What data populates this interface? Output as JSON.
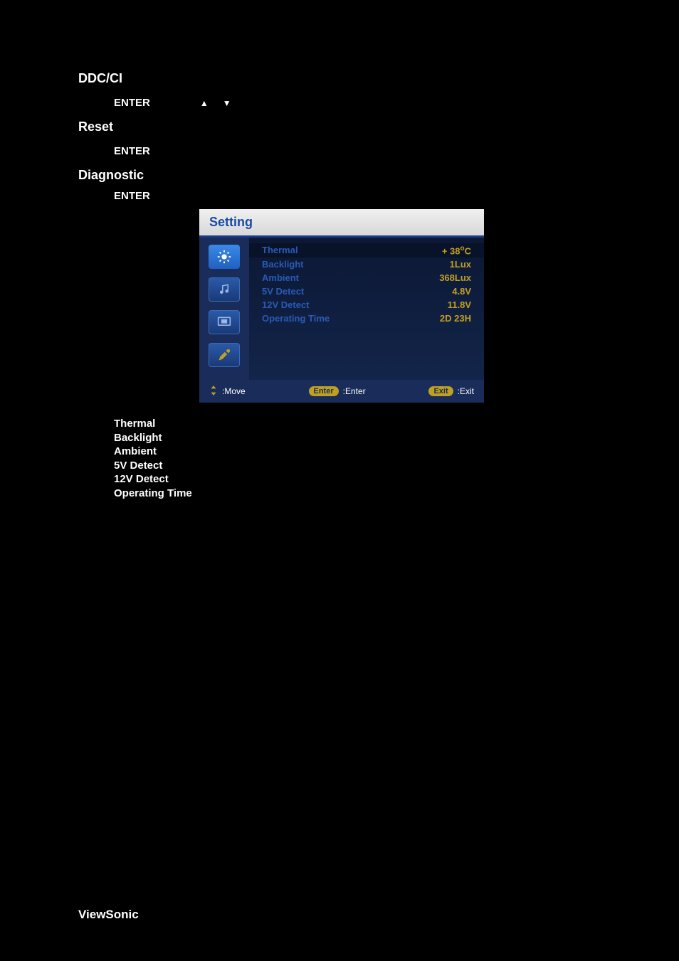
{
  "sections": {
    "ddcci": {
      "title": "DDC/CI",
      "enter": "ENTER"
    },
    "reset": {
      "title": "Reset",
      "enter": "ENTER"
    },
    "diagnostic": {
      "title": "Diagnostic",
      "enter": "ENTER"
    }
  },
  "osd": {
    "title": "Setting",
    "rows": [
      {
        "label": "Thermal",
        "value_prefix": "+ 38",
        "value_suffix": "C",
        "degree": "o"
      },
      {
        "label": "Backlight",
        "value": "1Lux"
      },
      {
        "label": "Ambient",
        "value": "368Lux"
      },
      {
        "label": "5V Detect",
        "value": "4.8V"
      },
      {
        "label": "12V Detect",
        "value": "11.8V"
      },
      {
        "label": "Operating Time",
        "value": "2D 23H"
      }
    ],
    "footer": {
      "move": ":Move",
      "enter_pill": "Enter",
      "enter_label": ":Enter",
      "exit_pill": "Exit",
      "exit_label": ":Exit"
    }
  },
  "list": {
    "thermal": "Thermal",
    "backlight": "Backlight",
    "ambient": "Ambient",
    "v5": "5V Detect",
    "v12": "12V Detect",
    "optime": "Operating Time"
  },
  "brand": "ViewSonic"
}
